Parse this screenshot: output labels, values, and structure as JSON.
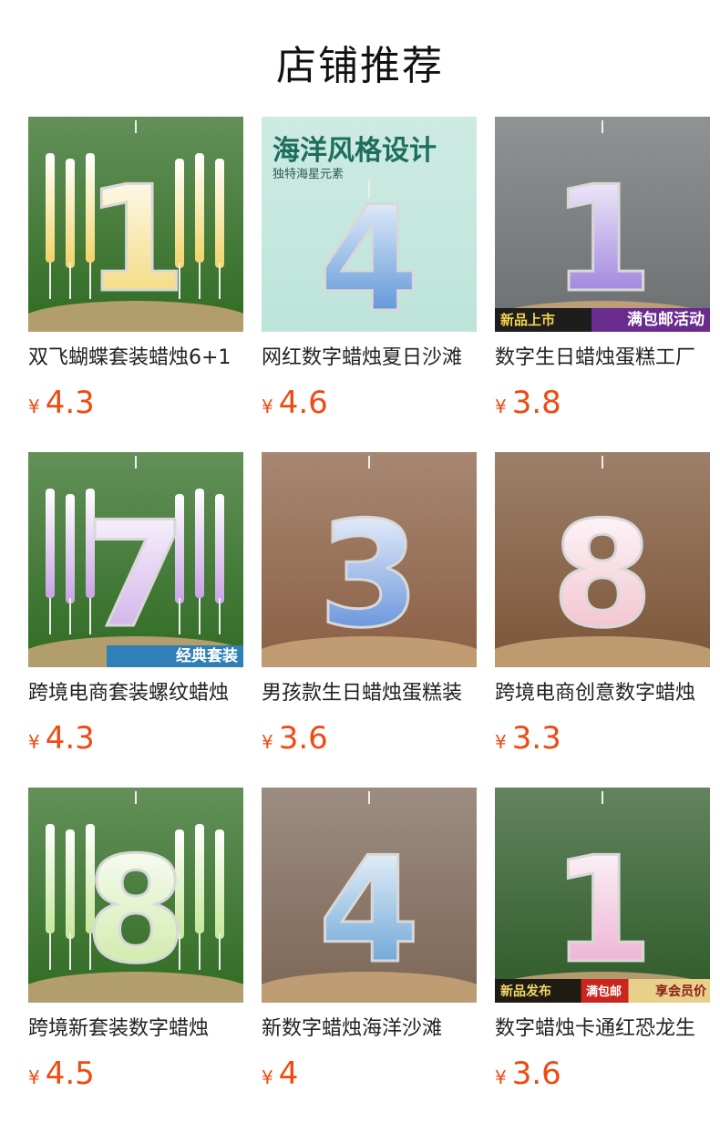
{
  "page": {
    "title": "店铺推荐"
  },
  "colors": {
    "price": "#f04a12",
    "title": "#111111"
  },
  "products": [
    {
      "name": "双飞蝴蝶套装蜡烛6+1",
      "currency": "¥",
      "price": "4.3",
      "image": {
        "digit": "1",
        "theme": "butterfly-set",
        "bg": "#2f6b22",
        "accent": "#f2d46a"
      }
    },
    {
      "name": "网红数字蜡烛夏日沙滩",
      "currency": "¥",
      "price": "4.6",
      "image": {
        "digit": "4",
        "theme": "ocean",
        "bg": "#bde4da",
        "accent": "#3c7fd0",
        "headline": "海洋风格设计",
        "subhead": "独特海星元素"
      }
    },
    {
      "name": "数字生日蜡烛蛋糕工厂",
      "currency": "¥",
      "price": "3.8",
      "image": {
        "digit": "1",
        "theme": "purple-butterfly",
        "bg": "#6b6f70",
        "accent": "#8c6bd6",
        "banner_left": "新品上市",
        "banner_right": "满包邮活动"
      }
    },
    {
      "name": "跨境电商套装螺纹蜡烛",
      "currency": "¥",
      "price": "4.3",
      "image": {
        "digit": "7",
        "theme": "spiral-set",
        "bg": "#2f6b22",
        "accent": "#c9a4e6",
        "banner": "经典套装"
      }
    },
    {
      "name": "男孩款生日蜡烛蛋糕装",
      "currency": "¥",
      "price": "3.6",
      "image": {
        "digit": "3",
        "theme": "dinosaur",
        "bg": "#8a5f44",
        "accent": "#4c7fd6"
      }
    },
    {
      "name": "跨境电商创意数字蜡烛",
      "currency": "¥",
      "price": "3.3",
      "image": {
        "digit": "8",
        "theme": "pink-bow",
        "bg": "#7c5538",
        "accent": "#efb8c8"
      }
    },
    {
      "name": "跨境新套装数字蜡烛",
      "currency": "¥",
      "price": "4.5",
      "image": {
        "digit": "8",
        "theme": "green-set",
        "bg": "#2f6b22",
        "accent": "#c7e79b"
      }
    },
    {
      "name": "新数字蜡烛海洋沙滩",
      "currency": "¥",
      "price": "4",
      "image": {
        "digit": "4",
        "theme": "shell",
        "bg": "#7c6656",
        "accent": "#4f94cf"
      }
    },
    {
      "name": "数字蜡烛卡通红恐龙生",
      "currency": "¥",
      "price": "3.6",
      "image": {
        "digit": "1",
        "theme": "red-dino",
        "bg": "#2e5a28",
        "accent": "#e9a3c9",
        "banner_left": "新品发布",
        "banner_mid": "满包邮",
        "banner_right": "享会员价"
      }
    }
  ]
}
